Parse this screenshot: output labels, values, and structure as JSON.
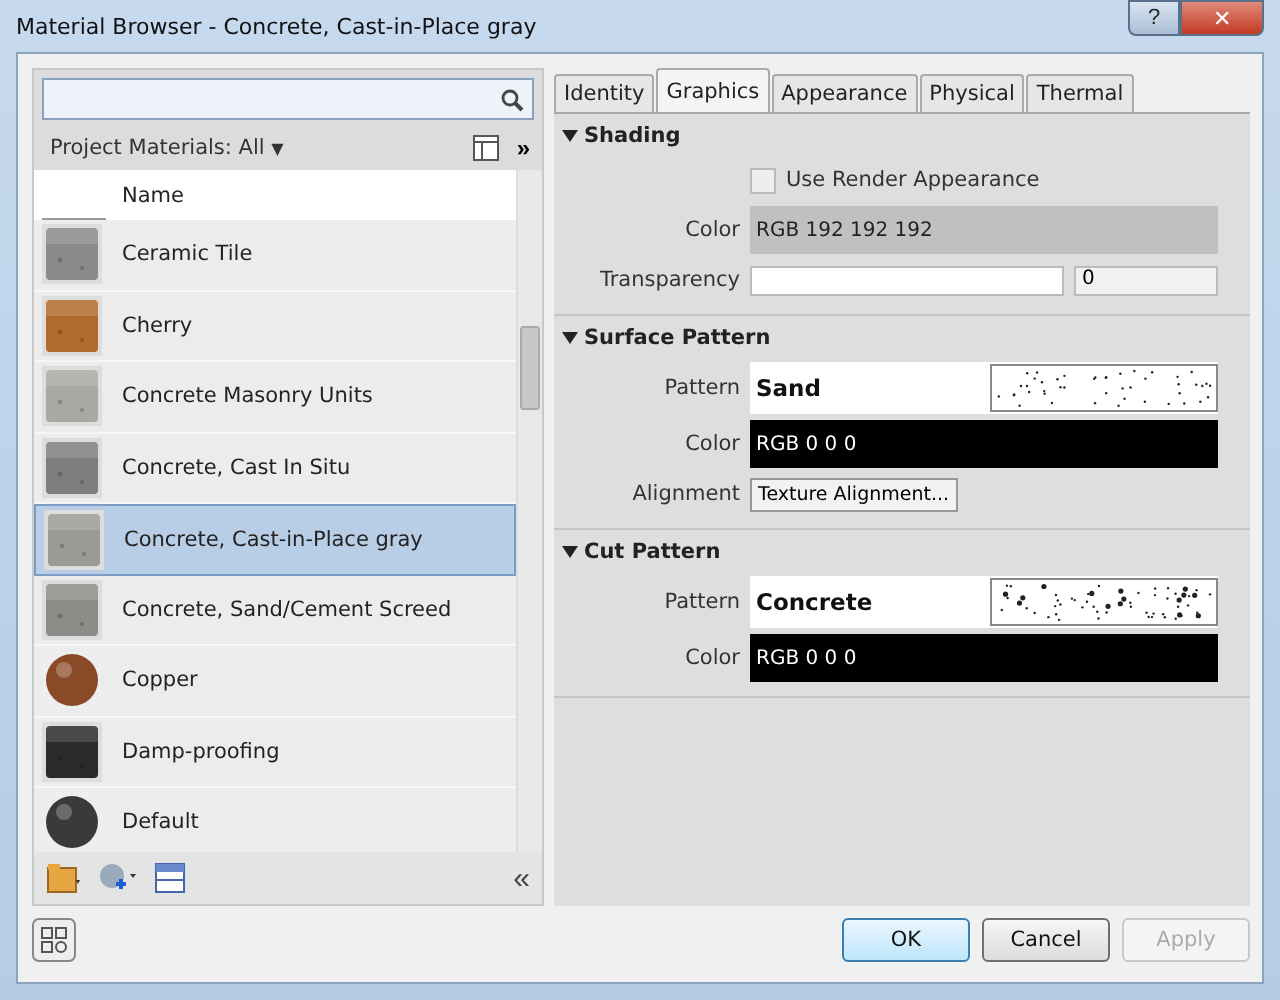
{
  "window": {
    "title": "Material Browser - Concrete, Cast-in-Place gray",
    "help": "?",
    "close": "✕"
  },
  "library": {
    "label": "Project Materials: All",
    "caret": "▼",
    "expand": "»"
  },
  "list": {
    "column": "Name",
    "items": [
      {
        "name": "Ceramic Tile",
        "selected": false
      },
      {
        "name": "Cherry",
        "selected": false
      },
      {
        "name": "Concrete Masonry Units",
        "selected": false
      },
      {
        "name": "Concrete, Cast In Situ",
        "selected": false
      },
      {
        "name": "Concrete, Cast-in-Place gray",
        "selected": true
      },
      {
        "name": "Concrete, Sand/Cement Screed",
        "selected": false
      },
      {
        "name": "Copper",
        "selected": false
      },
      {
        "name": "Damp-proofing",
        "selected": false
      },
      {
        "name": "Default",
        "selected": false
      }
    ]
  },
  "toolbar": {
    "collapse": "«"
  },
  "tabs": [
    {
      "label": "Identity",
      "selected": false
    },
    {
      "label": "Graphics",
      "selected": true
    },
    {
      "label": "Appearance",
      "selected": false
    },
    {
      "label": "Physical",
      "selected": false
    },
    {
      "label": "Thermal",
      "selected": false
    }
  ],
  "sections": [
    {
      "title": "Shading",
      "expanded": true,
      "rows": [
        {
          "kind": "checkbox",
          "text": "Use Render Appearance",
          "checked": false
        },
        {
          "kind": "color",
          "label": "Color",
          "value": "RGB 192 192 192",
          "color": "#c0c0c0"
        },
        {
          "kind": "slider",
          "label": "Transparency",
          "level": 0,
          "reading": "0"
        }
      ]
    },
    {
      "title": "Surface Pattern",
      "expanded": true,
      "rows": [
        {
          "kind": "pattern",
          "label": "Pattern",
          "value": "Sand"
        },
        {
          "kind": "color",
          "label": "Color",
          "value": "RGB 0 0 0",
          "color": "#000000"
        },
        {
          "kind": "button",
          "label": "Alignment",
          "value": "Texture Alignment..."
        }
      ]
    },
    {
      "title": "Cut Pattern",
      "expanded": true,
      "rows": [
        {
          "kind": "pattern",
          "label": "Pattern",
          "value": "Concrete"
        },
        {
          "kind": "color",
          "label": "Color",
          "value": "RGB 0 0 0",
          "color": "#000000"
        }
      ]
    }
  ],
  "buttons": [
    {
      "label": "OK",
      "disabled": false
    },
    {
      "label": "Cancel",
      "disabled": false
    },
    {
      "label": "Apply",
      "disabled": true
    }
  ]
}
